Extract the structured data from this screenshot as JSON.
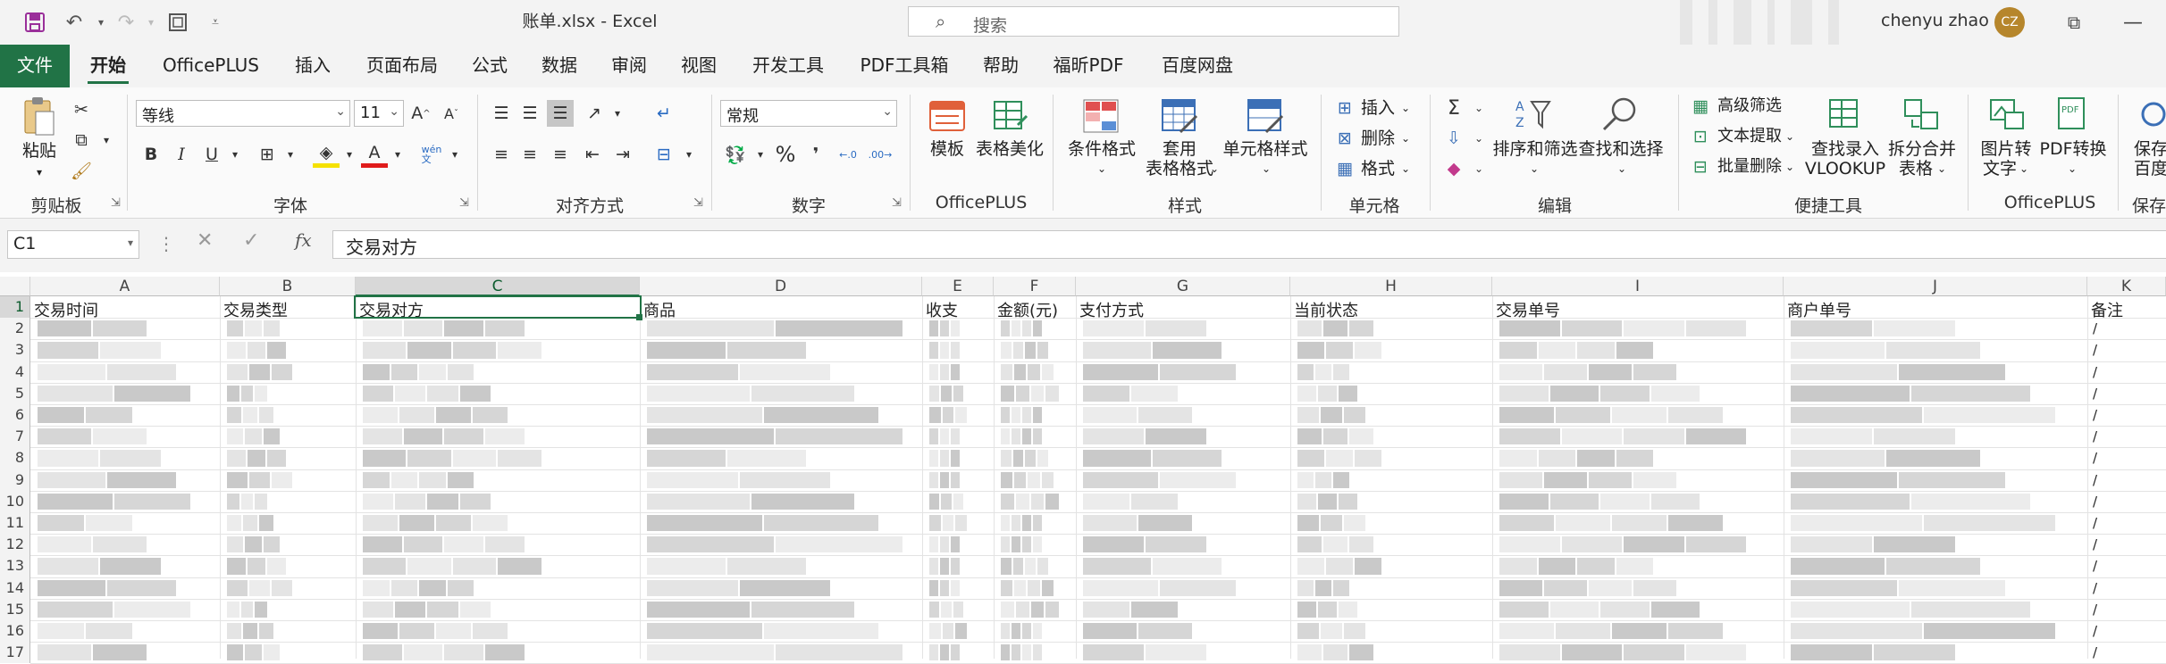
{
  "titlebar": {
    "title": "账单.xlsx  -  Excel",
    "search_placeholder": "搜索",
    "user_name": "chenyu zhao",
    "avatar_initials": "CZ"
  },
  "tabs": {
    "file": "文件",
    "home": "开始",
    "officeplus": "OfficePLUS",
    "insert": "插入",
    "page_layout": "页面布局",
    "formulas": "公式",
    "data": "数据",
    "review": "审阅",
    "view": "视图",
    "developer": "开发工具",
    "pdf_tools": "PDF工具箱",
    "help": "帮助",
    "foxit_pdf": "福昕PDF",
    "baidu_netdisk": "百度网盘"
  },
  "ribbon": {
    "clipboard": {
      "paste": "粘贴",
      "group": "剪贴板"
    },
    "font": {
      "font_name": "等线",
      "font_size": "11",
      "bold": "B",
      "italic": "I",
      "underline": "U",
      "group": "字体"
    },
    "alignment": {
      "group": "对齐方式"
    },
    "number": {
      "format": "常规",
      "percent": "%",
      "group": "数字"
    },
    "officeplus1": {
      "template": "模板",
      "table_beautify": "表格美化",
      "group": "OfficePLUS"
    },
    "styles": {
      "conditional": "条件格式",
      "format_table_line1": "套用",
      "format_table_line2": "表格格式",
      "cell_styles": "单元格样式",
      "group": "样式"
    },
    "cells": {
      "insert": "插入",
      "delete": "删除",
      "format": "格式",
      "group": "单元格"
    },
    "editing": {
      "sort_filter": "排序和筛选",
      "find_select": "查找和选择",
      "group": "编辑"
    },
    "quick_tools": {
      "advanced_filter": "高级筛选",
      "text_extract": "文本提取",
      "batch_delete": "批量删除",
      "vlookup_line1": "查找录入",
      "vlookup_line2": "VLOOKUP",
      "split_merge_line1": "拆分合并",
      "split_merge_line2": "表格",
      "group": "便捷工具"
    },
    "officeplus2": {
      "img_to_text_line1": "图片转",
      "img_to_text_line2": "文字",
      "pdf_convert": "PDF转换",
      "group": "OfficePLUS"
    },
    "save_cut_line1": "保存",
    "save_cut_line2": "百度网",
    "save_group_cut": "保存"
  },
  "formula_bar": {
    "name_box": "C1",
    "formula": "交易对方"
  },
  "columns": [
    "A",
    "B",
    "C",
    "D",
    "E",
    "F",
    "G",
    "H",
    "I",
    "J",
    "K"
  ],
  "header_row": [
    "交易时间",
    "交易类型",
    "交易对方",
    "商品",
    "收支",
    "金额(元)",
    "支付方式",
    "当前状态",
    "交易单号",
    "商户单号",
    "备注"
  ],
  "row_numbers": [
    "1",
    "2",
    "3",
    "4",
    "5",
    "6",
    "7",
    "8",
    "9",
    "10",
    "11",
    "12",
    "13",
    "14",
    "15",
    "16",
    "17"
  ],
  "remark_value": "/",
  "colors": {
    "excel_green": "#217346",
    "avatar": "#b6862c",
    "blur_light": "#e4e4e4",
    "blur_dark": "#c9c9c9"
  }
}
